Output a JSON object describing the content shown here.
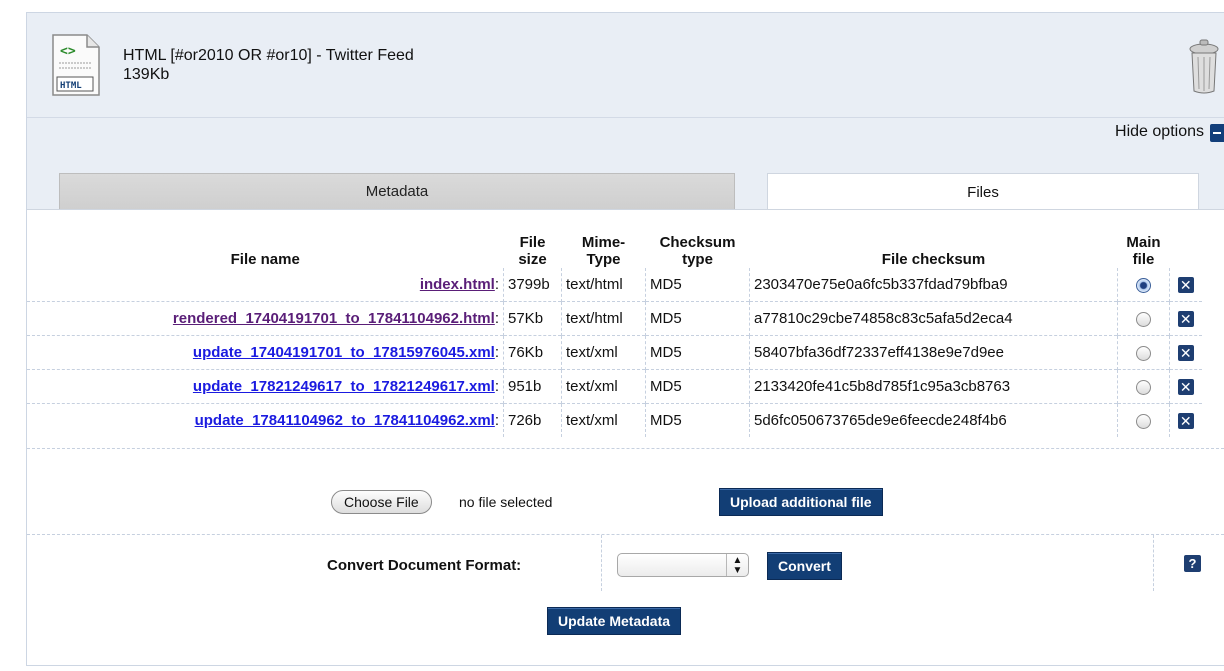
{
  "item": {
    "file_type_icon": "html-document-icon",
    "file_type_label": "HTML",
    "title": "HTML [#or2010 OR #or10] - Twitter Feed",
    "size": "139Kb",
    "delete_icon": "trash-icon"
  },
  "options": {
    "hide_label": "Hide options",
    "hide_icon": "collapse-icon"
  },
  "tabs": [
    {
      "label": "Metadata",
      "active": false
    },
    {
      "label": "Files",
      "active": true
    }
  ],
  "table": {
    "headers": {
      "file_name": "File name",
      "file_size_1": "File",
      "file_size_2": "size",
      "mime_1": "Mime-",
      "mime_2": "Type",
      "checksum_type_1": "Checksum",
      "checksum_type_2": "type",
      "file_checksum": "File checksum",
      "main_file_1": "Main",
      "main_file_2": "file"
    },
    "rows": [
      {
        "name": "index.html",
        "size": "3799b",
        "mime": "text/html",
        "ctype": "MD5",
        "checksum": "2303470e75e0a6fc5b337fdad79bfba9",
        "main": true
      },
      {
        "name": "rendered_17404191701_to_17841104962.html",
        "size": "57Kb",
        "mime": "text/html",
        "ctype": "MD5",
        "checksum": "a77810c29cbe74858c83c5afa5d2eca4",
        "main": false
      },
      {
        "name": "update_17404191701_to_17815976045.xml",
        "size": "76Kb",
        "mime": "text/xml",
        "ctype": "MD5",
        "checksum": "58407bfa36df72337eff4138e9e7d9ee",
        "main": false
      },
      {
        "name": "update_17821249617_to_17821249617.xml",
        "size": "951b",
        "mime": "text/xml",
        "ctype": "MD5",
        "checksum": "2133420fe41c5b8d785f1c95a3cb8763",
        "main": false
      },
      {
        "name": "update_17841104962_to_17841104962.xml",
        "size": "726b",
        "mime": "text/xml",
        "ctype": "MD5",
        "checksum": "5d6fc050673765de9e6feecde248f4b6",
        "main": false
      }
    ],
    "delete_glyph": "✕"
  },
  "upload": {
    "choose_label": "Choose File",
    "no_file": "no file selected",
    "upload_label": "Upload additional file"
  },
  "convert": {
    "label": "Convert Document Format:",
    "selected": "",
    "button": "Convert",
    "help": "?"
  },
  "update_label": "Update Metadata"
}
